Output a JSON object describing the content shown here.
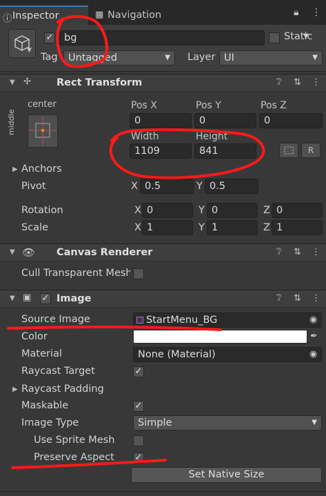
{
  "tabs": [
    {
      "label": "Inspector",
      "icon": "info-icon"
    },
    {
      "label": "Navigation",
      "icon": "navigation-icon"
    }
  ],
  "header": {
    "active": true,
    "name": "bg",
    "static_label": "Static",
    "tag_label": "Tag",
    "tag_value": "Untagged",
    "layer_label": "Layer",
    "layer_value": "UI"
  },
  "rect_transform": {
    "title": "Rect Transform",
    "anchor_preset_label": "center",
    "anchor_side_label": "middle",
    "col_labels": [
      "Pos X",
      "Pos Y",
      "Pos Z"
    ],
    "pos": [
      "0",
      "0",
      "0"
    ],
    "size_labels": [
      "Width",
      "Height"
    ],
    "size": [
      "1109",
      "841"
    ],
    "anchors_label": "Anchors",
    "pivot_label": "Pivot",
    "pivot": {
      "x_label": "X",
      "x": "0.5",
      "y_label": "Y",
      "y": "0.5"
    },
    "rotation_label": "Rotation",
    "rotation": {
      "x_label": "X",
      "x": "0",
      "y_label": "Y",
      "y": "0",
      "z_label": "Z",
      "z": "0"
    },
    "scale_label": "Scale",
    "scale": {
      "x_label": "X",
      "x": "1",
      "y_label": "Y",
      "y": "1",
      "z_label": "Z",
      "z": "1"
    },
    "r_button": "R"
  },
  "canvas_renderer": {
    "title": "Canvas Renderer",
    "cull_label": "Cull Transparent Mesh",
    "cull_checked": false
  },
  "image": {
    "title": "Image",
    "source_image_label": "Source Image",
    "source_image_value": "StartMenu_BG",
    "color_label": "Color",
    "color_value": "#ffffff",
    "material_label": "Material",
    "material_value": "None (Material)",
    "raycast_target_label": "Raycast Target",
    "raycast_target_checked": true,
    "raycast_padding_label": "Raycast Padding",
    "maskable_label": "Maskable",
    "maskable_checked": true,
    "image_type_label": "Image Type",
    "image_type_value": "Simple",
    "use_sprite_mesh_label": "Use Sprite Mesh",
    "use_sprite_mesh_checked": false,
    "preserve_aspect_label": "Preserve Aspect",
    "preserve_aspect_checked": true,
    "set_native_size_label": "Set Native Size"
  },
  "colors": {
    "accent": "#3a79bb",
    "annotation": "#ff1a1a",
    "panel": "#383838"
  }
}
